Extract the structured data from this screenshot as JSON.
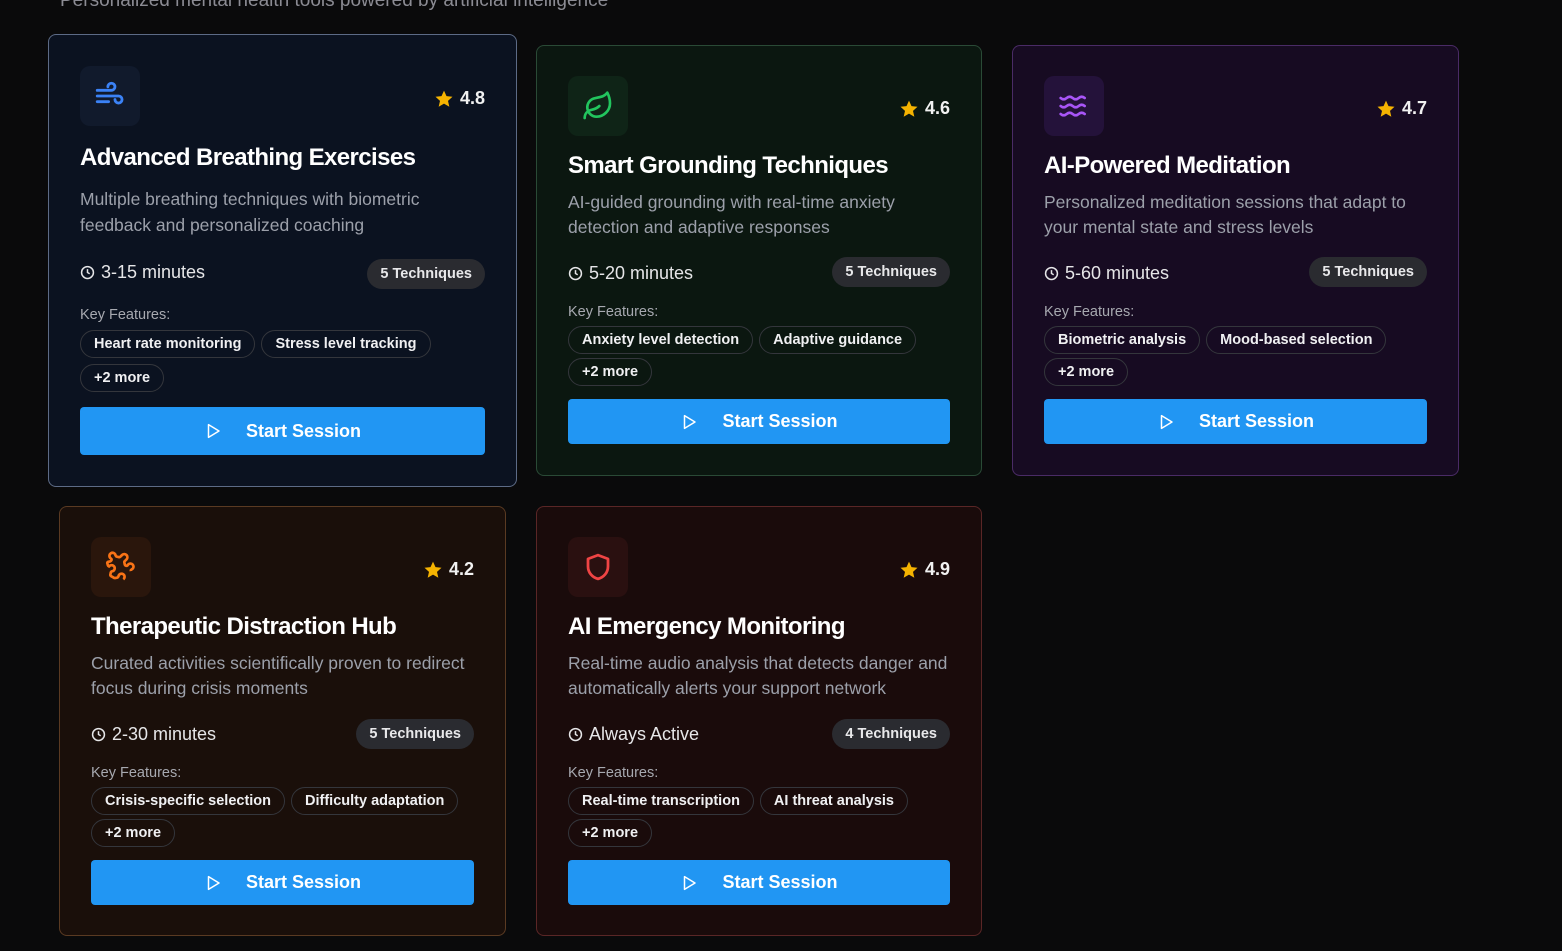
{
  "header": {
    "subtitle": "Personalized mental health tools powered by artificial intelligence"
  },
  "common": {
    "key_features_label": "Key Features:",
    "start_label": "Start Session"
  },
  "colors": {
    "accent": "#2196f3",
    "star": "#f5b301"
  },
  "cards": [
    {
      "title": "Advanced Breathing Exercises",
      "rating": "4.8",
      "icon": "wind-icon",
      "icon_color": "#3b82f6",
      "description": "Multiple breathing techniques with biometric feedback and personalized coaching",
      "duration": "3-15 minutes",
      "techniques": "5 Techniques",
      "features": [
        "Heart rate monitoring",
        "Stress level tracking"
      ],
      "more": "+2 more"
    },
    {
      "title": "Smart Grounding Techniques",
      "rating": "4.6",
      "icon": "leaf-icon",
      "icon_color": "#22c55e",
      "description": "AI-guided grounding with real-time anxiety detection and adaptive responses",
      "duration": "5-20 minutes",
      "techniques": "5 Techniques",
      "features": [
        "Anxiety level detection",
        "Adaptive guidance"
      ],
      "more": "+2 more"
    },
    {
      "title": "AI-Powered Meditation",
      "rating": "4.7",
      "icon": "waves-icon",
      "icon_color": "#a855f7",
      "description": "Personalized meditation sessions that adapt to your mental state and stress levels",
      "duration": "5-60 minutes",
      "techniques": "5 Techniques",
      "features": [
        "Biometric analysis",
        "Mood-based selection"
      ],
      "more": "+2 more"
    },
    {
      "title": "Therapeutic Distraction Hub",
      "rating": "4.2",
      "icon": "puzzle-icon",
      "icon_color": "#f97316",
      "description": "Curated activities scientifically proven to redirect focus during crisis moments",
      "duration": "2-30 minutes",
      "techniques": "5 Techniques",
      "features": [
        "Crisis-specific selection",
        "Difficulty adaptation"
      ],
      "more": "+2 more"
    },
    {
      "title": "AI Emergency Monitoring",
      "rating": "4.9",
      "icon": "shield-icon",
      "icon_color": "#ef4444",
      "description": "Real-time audio analysis that detects danger and automatically alerts your support network",
      "duration": "Always Active",
      "techniques": "4 Techniques",
      "features": [
        "Real-time transcription",
        "AI threat analysis"
      ],
      "more": "+2 more"
    }
  ]
}
